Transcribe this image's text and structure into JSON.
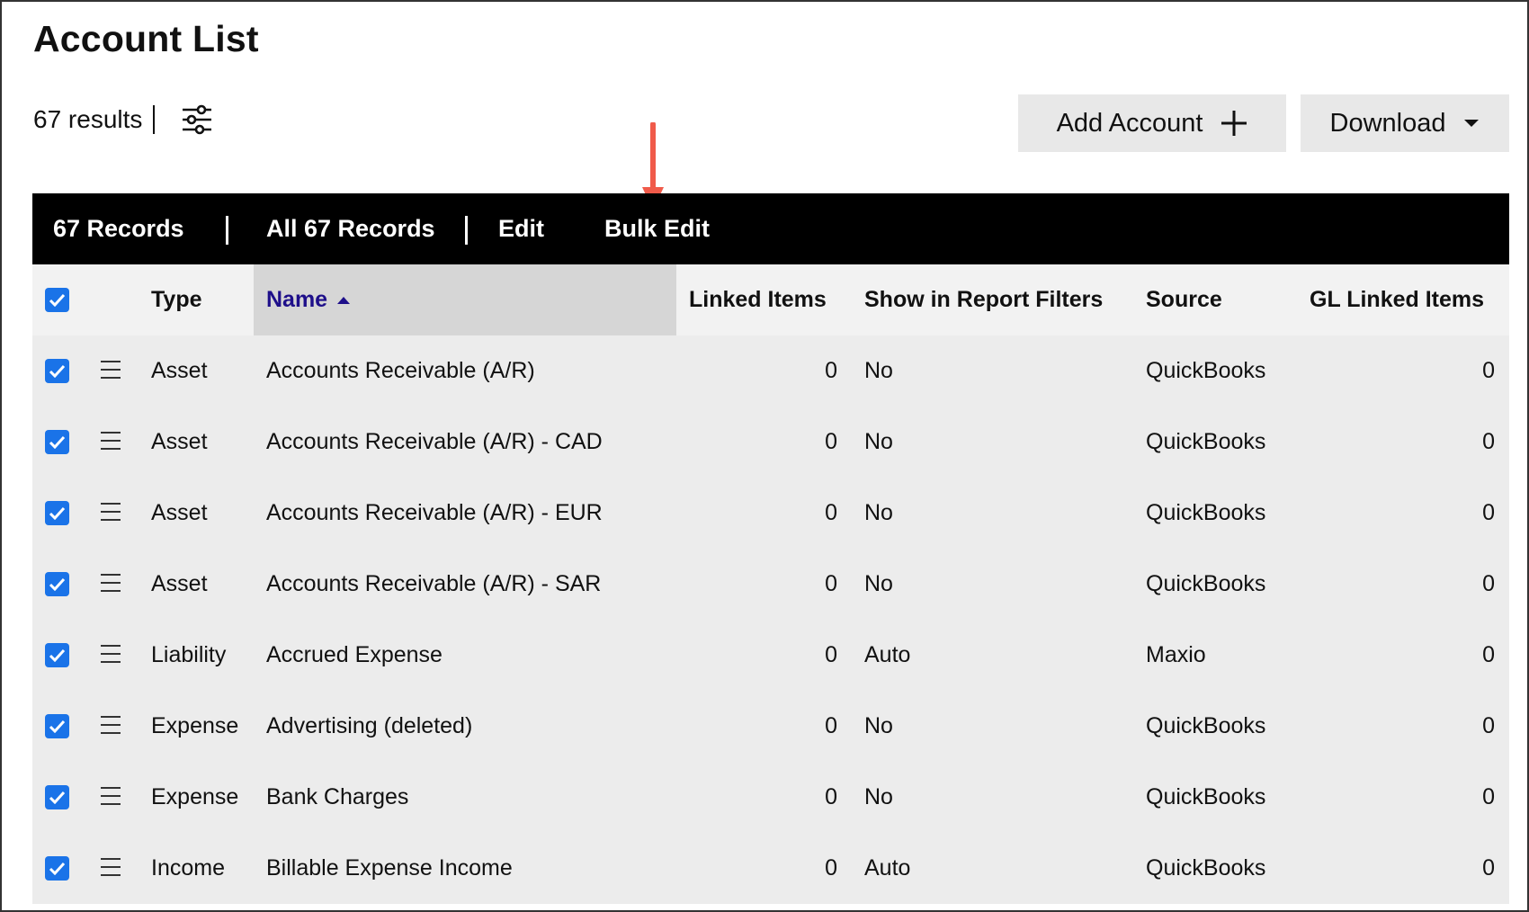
{
  "page": {
    "title": "Account List"
  },
  "results": {
    "count_text": "67 results"
  },
  "buttons": {
    "add_account": "Add Account",
    "download": "Download"
  },
  "toolbar": {
    "records": "67 Records",
    "all_records": "All 67 Records",
    "edit": "Edit",
    "bulk_edit": "Bulk Edit"
  },
  "colors": {
    "accent": "#1a73e8",
    "sort_link": "#1e0f8a",
    "annotation_arrow": "#f05a4a"
  },
  "table": {
    "headers": {
      "type": "Type",
      "name": "Name",
      "linked_items": "Linked Items",
      "show_in_report_filters": "Show in Report Filters",
      "source": "Source",
      "gl_linked_items": "GL Linked Items"
    },
    "rows": [
      {
        "checked": true,
        "type": "Asset",
        "name": "Accounts Receivable (A/R)",
        "linked": "0",
        "report": "No",
        "source": "QuickBooks",
        "gl": "0"
      },
      {
        "checked": true,
        "type": "Asset",
        "name": "Accounts Receivable (A/R) - CAD",
        "linked": "0",
        "report": "No",
        "source": "QuickBooks",
        "gl": "0"
      },
      {
        "checked": true,
        "type": "Asset",
        "name": "Accounts Receivable (A/R) - EUR",
        "linked": "0",
        "report": "No",
        "source": "QuickBooks",
        "gl": "0"
      },
      {
        "checked": true,
        "type": "Asset",
        "name": "Accounts Receivable (A/R) - SAR",
        "linked": "0",
        "report": "No",
        "source": "QuickBooks",
        "gl": "0"
      },
      {
        "checked": true,
        "type": "Liability",
        "name": "Accrued Expense",
        "linked": "0",
        "report": "Auto",
        "source": "Maxio",
        "gl": "0"
      },
      {
        "checked": true,
        "type": "Expense",
        "name": "Advertising (deleted)",
        "linked": "0",
        "report": "No",
        "source": "QuickBooks",
        "gl": "0"
      },
      {
        "checked": true,
        "type": "Expense",
        "name": "Bank Charges",
        "linked": "0",
        "report": "No",
        "source": "QuickBooks",
        "gl": "0"
      },
      {
        "checked": true,
        "type": "Income",
        "name": "Billable Expense Income",
        "linked": "0",
        "report": "Auto",
        "source": "QuickBooks",
        "gl": "0"
      }
    ]
  }
}
